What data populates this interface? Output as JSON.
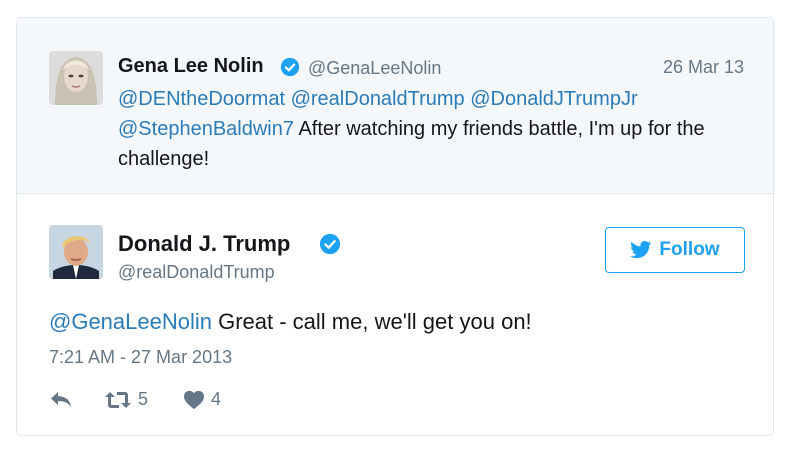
{
  "quoted_tweet": {
    "display_name": "Gena Lee Nolin",
    "handle": "@GenaLeeNolin",
    "date": "26 Mar 13",
    "mentions": [
      "@DENtheDoormat",
      "@realDonaldTrump",
      "@DonaldJTrumpJr",
      "@StephenBaldwin7"
    ],
    "text": " After watching my friends battle, I'm up for the challenge!"
  },
  "main_tweet": {
    "display_name": "Donald J. Trump",
    "handle": "@realDonaldTrump",
    "follow_label": "Follow",
    "mention": "@GenaLeeNolin",
    "text": " Great - call me, we'll get you on!",
    "timestamp": "7:21 AM - 27 Mar 2013",
    "retweet_count": "5",
    "like_count": "4"
  },
  "icons": {
    "verified": "verified-badge-icon",
    "bird": "twitter-bird-icon",
    "reply": "reply-icon",
    "retweet": "retweet-icon",
    "like": "heart-icon"
  },
  "colors": {
    "link": "#2b7bb9",
    "brand": "#1da1f2",
    "muted": "#657786",
    "quoted_bg": "#f5f8fa"
  }
}
